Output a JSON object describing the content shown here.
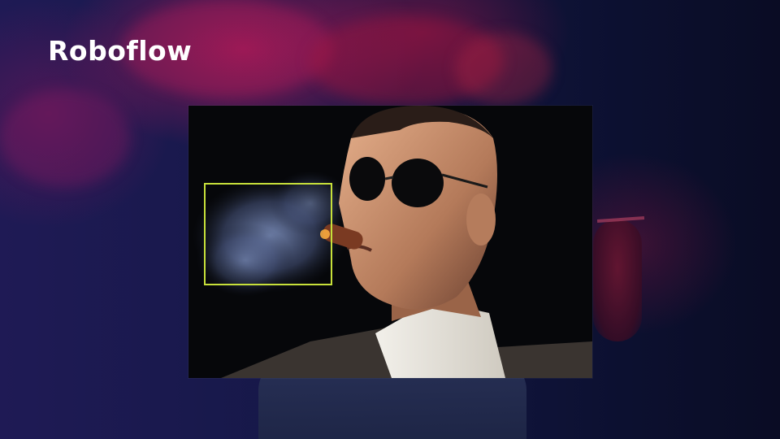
{
  "brand": {
    "logo_text": "Roboflow"
  },
  "image": {
    "subject": "man-with-sunglasses-smoking-cigar",
    "annotation": {
      "class_label": "",
      "box_color": "#c7e03a"
    }
  },
  "colors": {
    "background_left": "#1f1a55",
    "background_right": "#0a0c24",
    "smoke_magenta": "#b21858"
  }
}
